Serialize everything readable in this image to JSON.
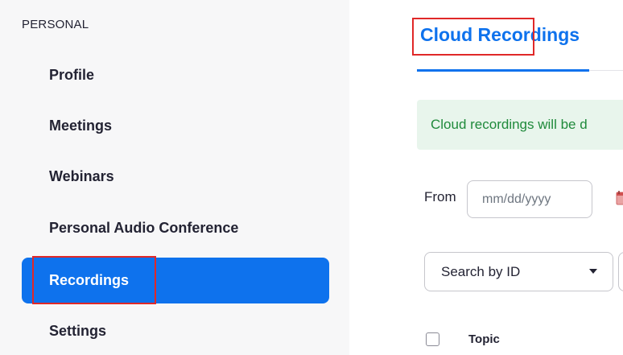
{
  "sidebar": {
    "section_label": "PERSONAL",
    "items": [
      {
        "label": "Profile",
        "active": false
      },
      {
        "label": "Meetings",
        "active": false
      },
      {
        "label": "Webinars",
        "active": false
      },
      {
        "label": "Personal Audio Conference",
        "active": false
      },
      {
        "label": "Recordings",
        "active": true
      },
      {
        "label": "Settings",
        "active": false
      }
    ]
  },
  "main": {
    "title": "Cloud Recordings",
    "banner_text": "Cloud recordings will be d",
    "filters": {
      "from_label": "From",
      "date_placeholder": "mm/dd/yyyy",
      "search_select_value": "Search by ID"
    },
    "table": {
      "columns": [
        "Topic"
      ]
    }
  },
  "colors": {
    "accent": "#0e72ed",
    "highlight_box": "#e02828",
    "banner_bg": "#e8f5ec",
    "banner_text": "#1f8a3b"
  },
  "icons": [
    "calendar-icon",
    "caret-down-icon"
  ]
}
